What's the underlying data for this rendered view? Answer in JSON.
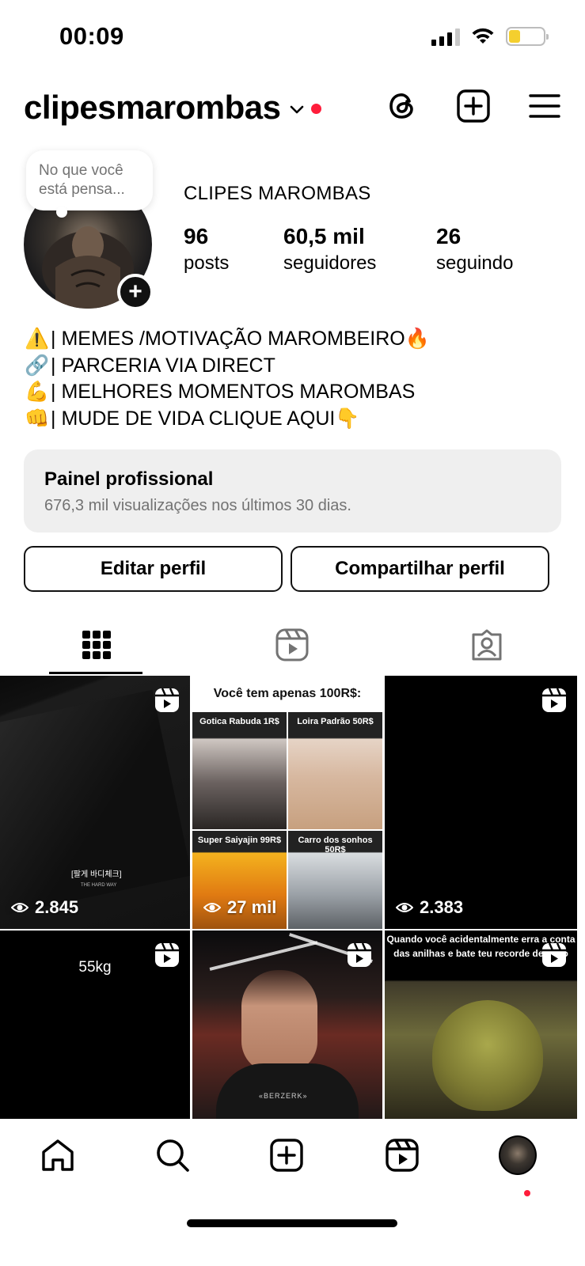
{
  "status_bar": {
    "time": "00:09"
  },
  "header": {
    "username": "clipesmarombas"
  },
  "profile": {
    "note": "No que você está pensa...",
    "display_name": "CLIPES MAROMBAS",
    "stats": [
      {
        "value": "96",
        "label": "posts"
      },
      {
        "value": "60,5 mil",
        "label": "seguidores"
      },
      {
        "value": "26",
        "label": "seguindo"
      }
    ],
    "bio": [
      {
        "emoji": "⚠️",
        "text": "| MEMES /MOTIVAÇÃO MAROMBEIRO ",
        "trail": "🔥"
      },
      {
        "emoji": "🔗",
        "text": "| PARCERIA VIA DIRECT",
        "trail": ""
      },
      {
        "emoji": "💪",
        "text": "| MELHORES MOMENTOS MAROMBAS",
        "trail": ""
      },
      {
        "emoji": "👊",
        "text": "| MUDE DE VIDA CLIQUE AQUI ",
        "trail": "👇"
      }
    ]
  },
  "dashboard": {
    "title": "Painel profissional",
    "subtitle": "676,3 mil visualizações nos últimos 30 dias."
  },
  "buttons": {
    "edit": "Editar perfil",
    "share": "Compartilhar perfil"
  },
  "posts": {
    "p1": {
      "views": "2.845",
      "caption": "[팔게 바디체크]",
      "brand": "THE HARD WAY"
    },
    "p2": {
      "views": "27 mil",
      "headline": "Você tem apenas 100R$:",
      "tiles": [
        "Gotica Rabuda 1R$",
        "Loira Padrão 50R$",
        "Super Saiyajin 99R$",
        "Carro dos sonhos 50R$"
      ]
    },
    "p3": {
      "views": "2.383"
    },
    "p4": {
      "text": "55kg"
    },
    "p5": {
      "print": "«BERZERK»"
    },
    "p6": {
      "text": "Quando você acidentalmente erra a conta das anilhas e bate teu recorde de peso"
    }
  }
}
